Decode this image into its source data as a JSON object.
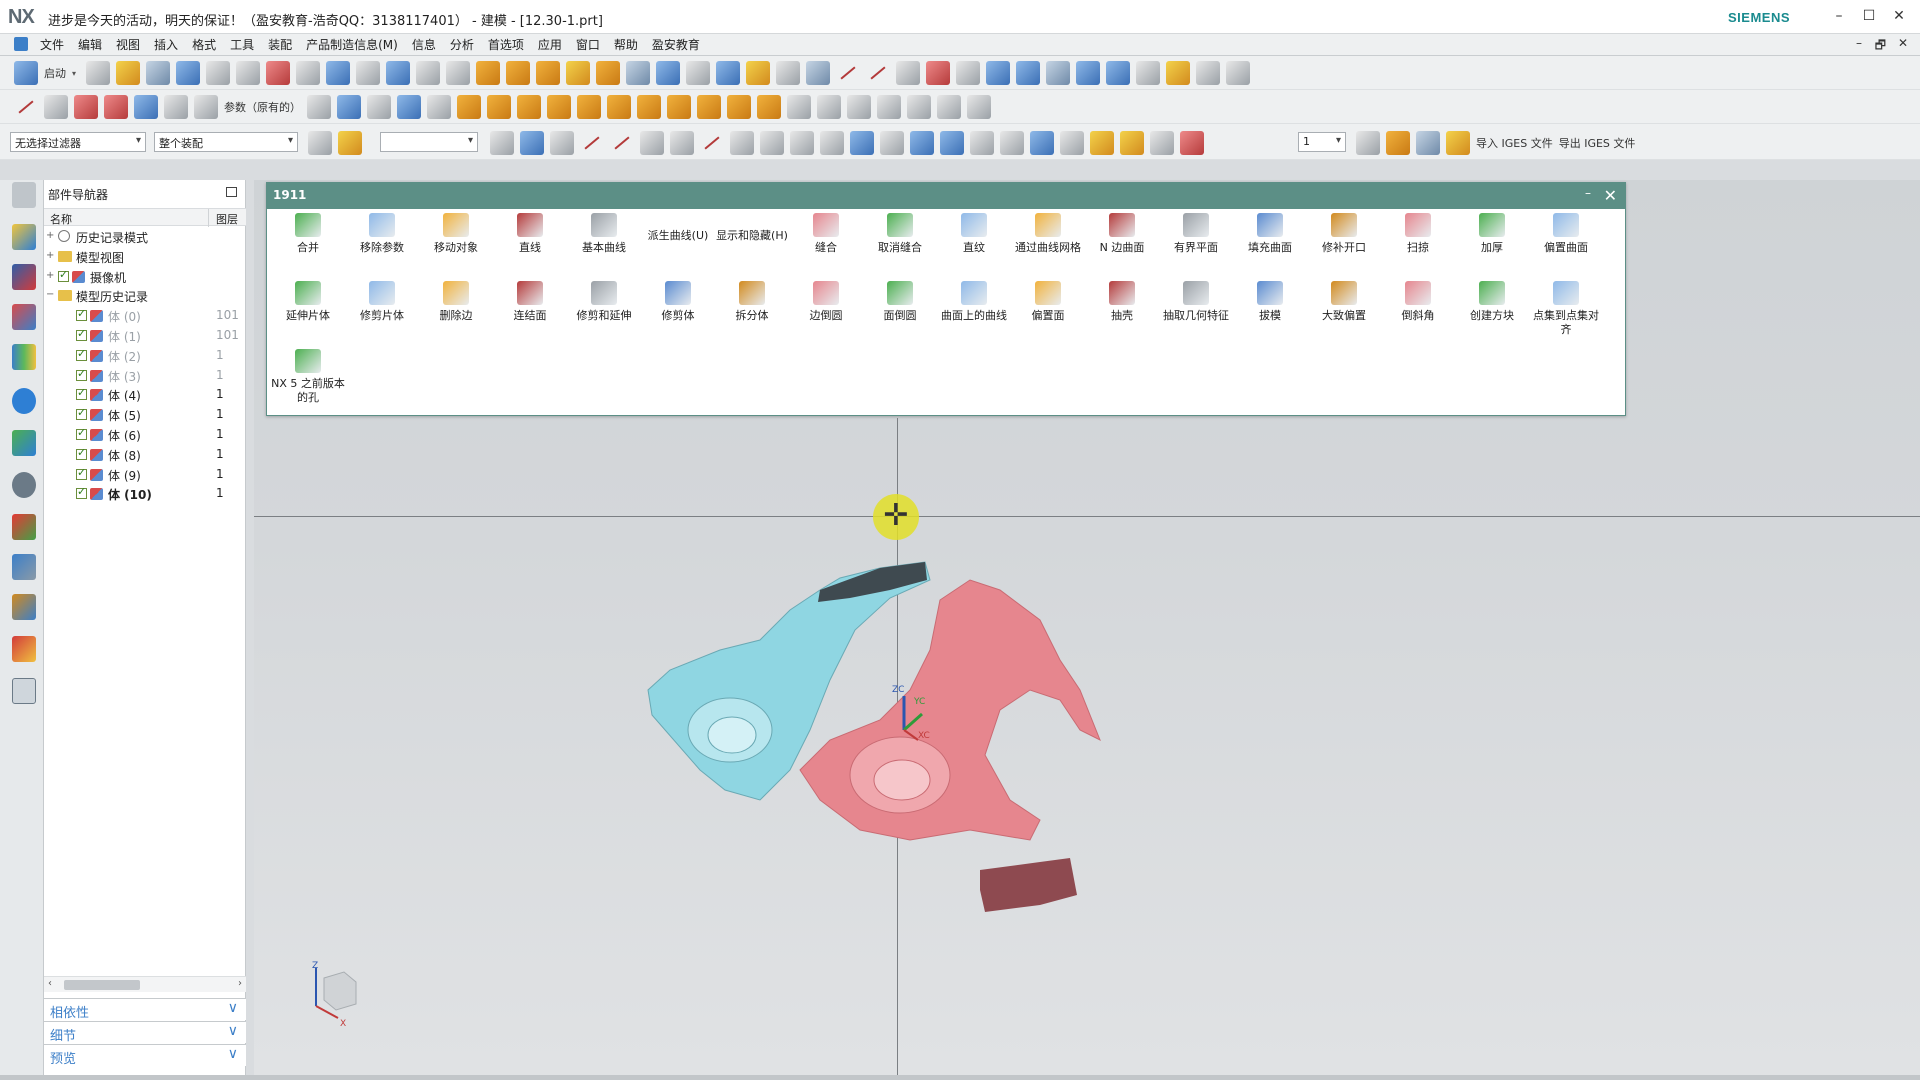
{
  "window": {
    "title": "进步是今天的活动，明天的保证！（盈安教育-浩奇QQ：3138117401） - 建模 - [12.30-1.prt]",
    "brand": "SIEMENS",
    "app_logo": "NX",
    "controls": [
      "–",
      "☐",
      "✕"
    ]
  },
  "menubar": {
    "items": [
      "文件",
      "编辑",
      "视图",
      "插入",
      "格式",
      "工具",
      "装配",
      "产品制造信息(M)",
      "信息",
      "分析",
      "首选项",
      "应用",
      "窗口",
      "帮助",
      "盈安教育"
    ],
    "mdi_controls": [
      "–",
      "🗗",
      "✕"
    ]
  },
  "toolbar1": {
    "start_label": "启动"
  },
  "toolbar2": {
    "param_label": "参数（原有的）"
  },
  "toolbar3": {
    "filter_combo": "无选择过滤器",
    "scope_combo": "整个装配",
    "layer_combo": "1",
    "import_iges": "导入 IGES 文件",
    "export_iges": "导出 IGES 文件"
  },
  "navigator": {
    "title": "部件导航器",
    "col_name": "名称",
    "col_layer": "图层",
    "rows": [
      {
        "label": "历史记录模式",
        "layer": "",
        "kind": "clock",
        "indent": 0,
        "dim": false,
        "bold": false
      },
      {
        "label": "模型视图",
        "layer": "",
        "kind": "folder",
        "indent": 0,
        "dim": false,
        "bold": false
      },
      {
        "label": "摄像机",
        "layer": "",
        "kind": "camera",
        "indent": 0,
        "dim": false,
        "bold": false
      },
      {
        "label": "模型历史记录",
        "layer": "",
        "kind": "folder",
        "indent": 0,
        "dim": false,
        "bold": false
      },
      {
        "label": "体 (0)",
        "layer": "101",
        "kind": "body",
        "indent": 1,
        "dim": true,
        "bold": false
      },
      {
        "label": "体 (1)",
        "layer": "101",
        "kind": "body",
        "indent": 1,
        "dim": true,
        "bold": false
      },
      {
        "label": "体 (2)",
        "layer": "1",
        "kind": "body",
        "indent": 1,
        "dim": true,
        "bold": false
      },
      {
        "label": "体 (3)",
        "layer": "1",
        "kind": "body",
        "indent": 1,
        "dim": true,
        "bold": false
      },
      {
        "label": "体 (4)",
        "layer": "1",
        "kind": "body",
        "indent": 1,
        "dim": false,
        "bold": false
      },
      {
        "label": "体 (5)",
        "layer": "1",
        "kind": "body",
        "indent": 1,
        "dim": false,
        "bold": false
      },
      {
        "label": "体 (6)",
        "layer": "1",
        "kind": "body",
        "indent": 1,
        "dim": false,
        "bold": false
      },
      {
        "label": "体 (8)",
        "layer": "1",
        "kind": "body",
        "indent": 1,
        "dim": false,
        "bold": false
      },
      {
        "label": "体 (9)",
        "layer": "1",
        "kind": "body",
        "indent": 1,
        "dim": false,
        "bold": false
      },
      {
        "label": "体 (10)",
        "layer": "1",
        "kind": "body",
        "indent": 1,
        "dim": false,
        "bold": true
      }
    ],
    "sections": [
      "相依性",
      "细节",
      "预览"
    ]
  },
  "dialog": {
    "title": "1911",
    "row1": [
      "合并",
      "移除参数",
      "移动对象",
      "直线",
      "基本曲线",
      "派生曲线(U)",
      "显示和隐藏(H)",
      "缝合",
      "取消缝合",
      "直纹",
      "通过曲线网格",
      "N 边曲面",
      "有界平面",
      "填充曲面",
      "修补开口",
      "扫掠",
      "加厚",
      "偏置曲面"
    ],
    "row2": [
      "延伸片体",
      "修剪片体",
      "删除边",
      "连结面",
      "修剪和延伸",
      "修剪体",
      "拆分体",
      "边倒圆",
      "面倒圆",
      "曲面上的曲线",
      "偏置面",
      "抽壳",
      "抽取几何特征",
      "拔模",
      "大致偏置",
      "倒斜角",
      "创建方块",
      "点集到点集对齐"
    ],
    "row3": [
      "NX 5 之前版本的孔"
    ],
    "row3_badge": "NX5"
  },
  "viewport": {
    "csys_labels": [
      "ZC",
      "YC",
      "XC"
    ],
    "triad_labels": [
      "Z",
      "X"
    ],
    "part_colors": {
      "cyan": "#8fd6e2",
      "pink": "#e6868e",
      "dark": "#8e4a50"
    }
  }
}
